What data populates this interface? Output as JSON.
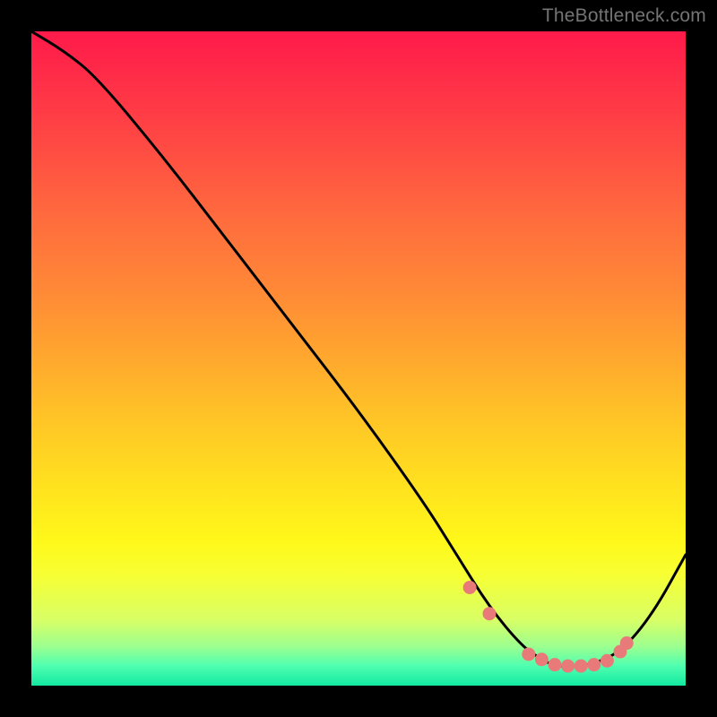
{
  "watermark": "TheBottleneck.com",
  "chart_data": {
    "type": "line",
    "title": "",
    "xlabel": "",
    "ylabel": "",
    "xlim": [
      0,
      100
    ],
    "ylim": [
      0,
      100
    ],
    "series": [
      {
        "name": "curve",
        "x": [
          0,
          5,
          10,
          20,
          30,
          40,
          50,
          60,
          65,
          70,
          75,
          78,
          80,
          82,
          85,
          90,
          95,
          100
        ],
        "values": [
          100,
          97,
          93,
          81,
          68,
          55,
          42,
          28,
          20,
          12,
          6,
          4,
          3,
          3,
          3,
          5,
          11,
          20
        ]
      }
    ],
    "markers": {
      "name": "highlight-points",
      "color": "#e97a7a",
      "x": [
        67,
        70,
        76,
        78,
        80,
        82,
        84,
        86,
        88,
        90,
        91
      ],
      "values": [
        15,
        11,
        4.8,
        4,
        3.2,
        3.0,
        3.0,
        3.2,
        3.8,
        5.2,
        6.5
      ]
    },
    "gradient_meaning": "vertical gradient from red (top, high y) through orange/yellow to green (bottom, low y)"
  },
  "colors": {
    "background": "#000000",
    "curve": "#000000",
    "marker": "#e97a7a",
    "watermark": "#747474"
  }
}
